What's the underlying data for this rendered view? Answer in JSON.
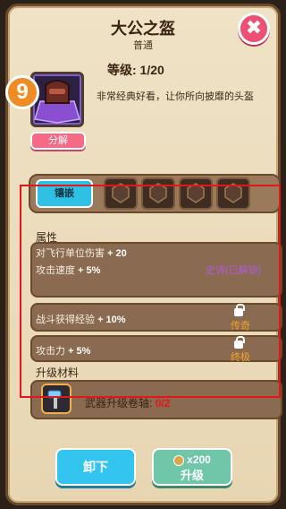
{
  "header": {
    "title": "大公之盔",
    "rarity": "普通",
    "close_symbol": "✖"
  },
  "item": {
    "badge_number": "9",
    "level_text": "等级: 1/20",
    "description": "非常经典好看，让你所向披靡的头盔",
    "decompose_label": "分解"
  },
  "slots": {
    "active_label": "镶嵌",
    "empty_count": 4
  },
  "attributes": {
    "section_label": "属性",
    "primary": [
      {
        "label": "对飞行单位伤害",
        "value": "+ 20"
      },
      {
        "label": "攻击速度",
        "value": "+ 5%",
        "tag": "史诗(已解锁)"
      }
    ],
    "locked": [
      {
        "label": "战斗获得经验",
        "value": "+ 10%",
        "tag": "传奇"
      },
      {
        "label": "攻击力",
        "value": "+ 5%",
        "tag": "终极"
      }
    ]
  },
  "materials": {
    "section_label": "升级材料",
    "name": "武器升级卷轴:",
    "count": "0/2"
  },
  "actions": {
    "unequip_label": "卸下",
    "upgrade_cost": "x200",
    "upgrade_label": "升级"
  },
  "colors": {
    "epic": "#b05be0",
    "legendary": "#f5a326",
    "ultimate": "#f5a326",
    "count_red": "#e3171b"
  }
}
